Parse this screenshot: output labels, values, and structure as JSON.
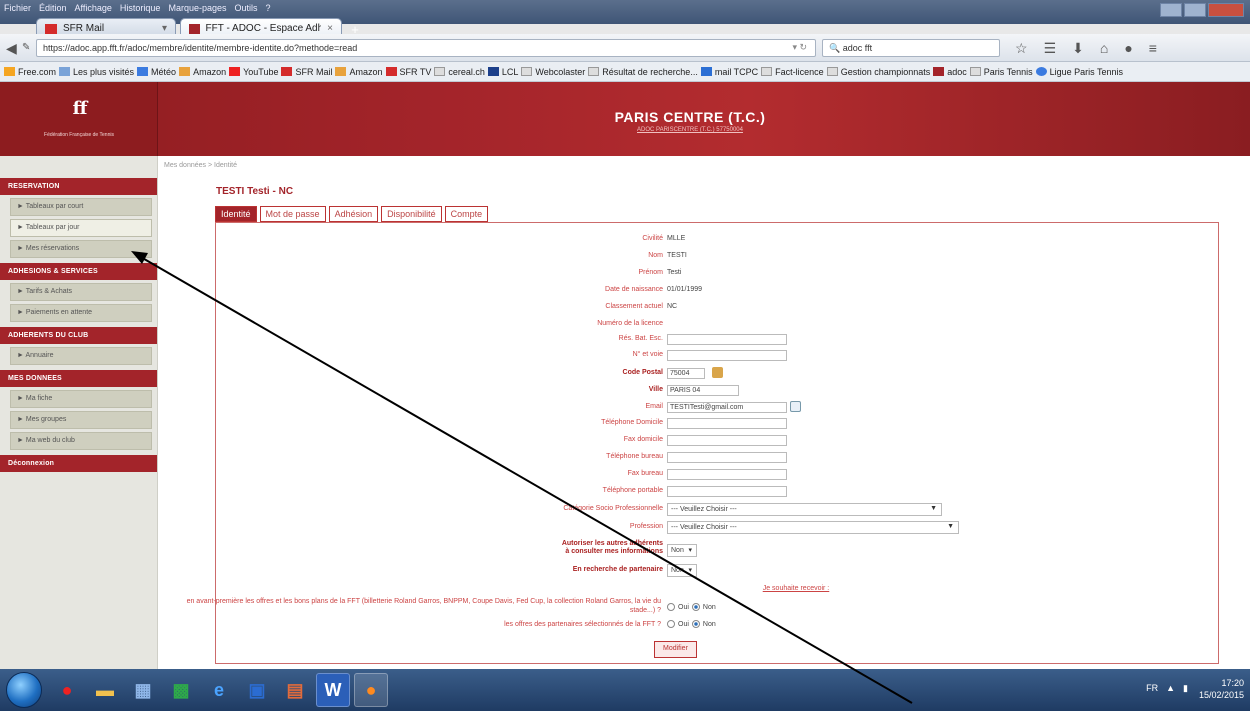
{
  "browser": {
    "menu": [
      "Fichier",
      "Édition",
      "Affichage",
      "Historique",
      "Marque-pages",
      "Outils",
      "?"
    ],
    "tabs": [
      {
        "label": "SFR Mail",
        "icon_color": "#d42b2b"
      },
      {
        "label": "FFT - ADOC - Espace Adhé...",
        "icon_color": "#a3242a"
      }
    ],
    "url": "https://adoc.app.fft.fr/adoc/membre/identite/membre-identite.do?methode=read",
    "search_value": "adoc fft",
    "bookmarks": [
      "Free.com",
      "Les plus visités",
      "Météo",
      "Amazon",
      "YouTube",
      "SFR Mail",
      "Amazon",
      "SFR TV",
      "cereal.ch",
      "LCL",
      "Webcolaster",
      "Résultat de recherche...",
      "mail TCPC",
      "Fact-licence",
      "Gestion championnats",
      "adoc",
      "Paris Tennis",
      "Ligue Paris Tennis"
    ]
  },
  "header": {
    "logo_text": "Fédération Française de Tennis",
    "club_name": "PARIS CENTRE (T.C.)",
    "club_sub": "ADOC PARISCENTRE (T.C.) 57750004"
  },
  "sidebar": {
    "sections": [
      {
        "title": "RESERVATION",
        "items": [
          {
            "label": "Tableaux par court",
            "active": false
          },
          {
            "label": "Tableaux par jour",
            "active": true
          },
          {
            "label": "Mes réservations",
            "active": false
          }
        ]
      },
      {
        "title": "ADHESIONS & SERVICES",
        "items": [
          {
            "label": "Tarifs & Achats",
            "active": false
          },
          {
            "label": "Paiements en attente",
            "active": false
          }
        ]
      },
      {
        "title": "ADHERENTS DU CLUB",
        "items": [
          {
            "label": "Annuaire",
            "active": false
          }
        ]
      },
      {
        "title": "MES DONNEES",
        "items": [
          {
            "label": "Ma fiche",
            "active": false
          },
          {
            "label": "Mes groupes",
            "active": false
          },
          {
            "label": "Ma web du club",
            "active": false
          }
        ]
      },
      {
        "title": "Déconnexion",
        "items": []
      }
    ]
  },
  "content": {
    "breadcrumb": "Mes données > Identité",
    "user_title": "TESTI Testi - NC",
    "tabs": [
      "Identité",
      "Mot de passe",
      "Adhésion",
      "Disponibilité",
      "Compte"
    ],
    "fields": {
      "civilite": {
        "label": "Civilité",
        "value": "MLLE"
      },
      "nom": {
        "label": "Nom",
        "value": "TESTI"
      },
      "prenom": {
        "label": "Prénom",
        "value": "Testi"
      },
      "naissance": {
        "label": "Date de naissance",
        "value": "01/01/1999"
      },
      "classement": {
        "label": "Classement actuel",
        "value": "NC"
      },
      "licence": {
        "label": "Numéro de la licence",
        "value": ""
      },
      "res": {
        "label": "Rés. Bat. Esc.",
        "value": ""
      },
      "voie": {
        "label": "N° et voie",
        "value": ""
      },
      "cp": {
        "label": "Code Postal",
        "value": "75004"
      },
      "ville": {
        "label": "Ville",
        "value": "PARIS 04"
      },
      "email": {
        "label": "Email",
        "value": "TESTITesti@gmail.com"
      },
      "tel_dom": {
        "label": "Téléphone Domicile",
        "value": ""
      },
      "fax_dom": {
        "label": "Fax domicile",
        "value": ""
      },
      "tel_bur": {
        "label": "Téléphone bureau",
        "value": ""
      },
      "fax_bur": {
        "label": "Fax bureau",
        "value": ""
      },
      "tel_port": {
        "label": "Téléphone portable",
        "value": ""
      },
      "csp": {
        "label": "Catégorie Socio Professionnelle",
        "value": "--- Veuillez Choisir ---"
      },
      "profession": {
        "label": "Profession",
        "value": "--- Veuillez Choisir ---"
      },
      "autoriser": {
        "label_line1": "Autoriser les autres adhérents",
        "label_line2": "à consulter mes informations",
        "value": "Non"
      },
      "recherche": {
        "label": "En recherche de partenaire",
        "value": "Non"
      }
    },
    "link": "Je souhaite recevoir :",
    "q1": "en avant-première les offres et les bons plans de la FFT (billetterie Roland Garros, BNPPM, Coupe Davis, Fed Cup, la collection Roland Garros, la vie du stade...) ?",
    "q2": "les offres des partenaires sélectionnés de la FFT ?",
    "yes": "Oui",
    "no": "Non",
    "modifier": "Modifier"
  },
  "taskbar": {
    "time": "17:20",
    "date": "15/02/2015",
    "lang": "FR"
  },
  "colors": {
    "brand_red": "#a3242a",
    "sidebar_bg": "#e6e6e0"
  }
}
